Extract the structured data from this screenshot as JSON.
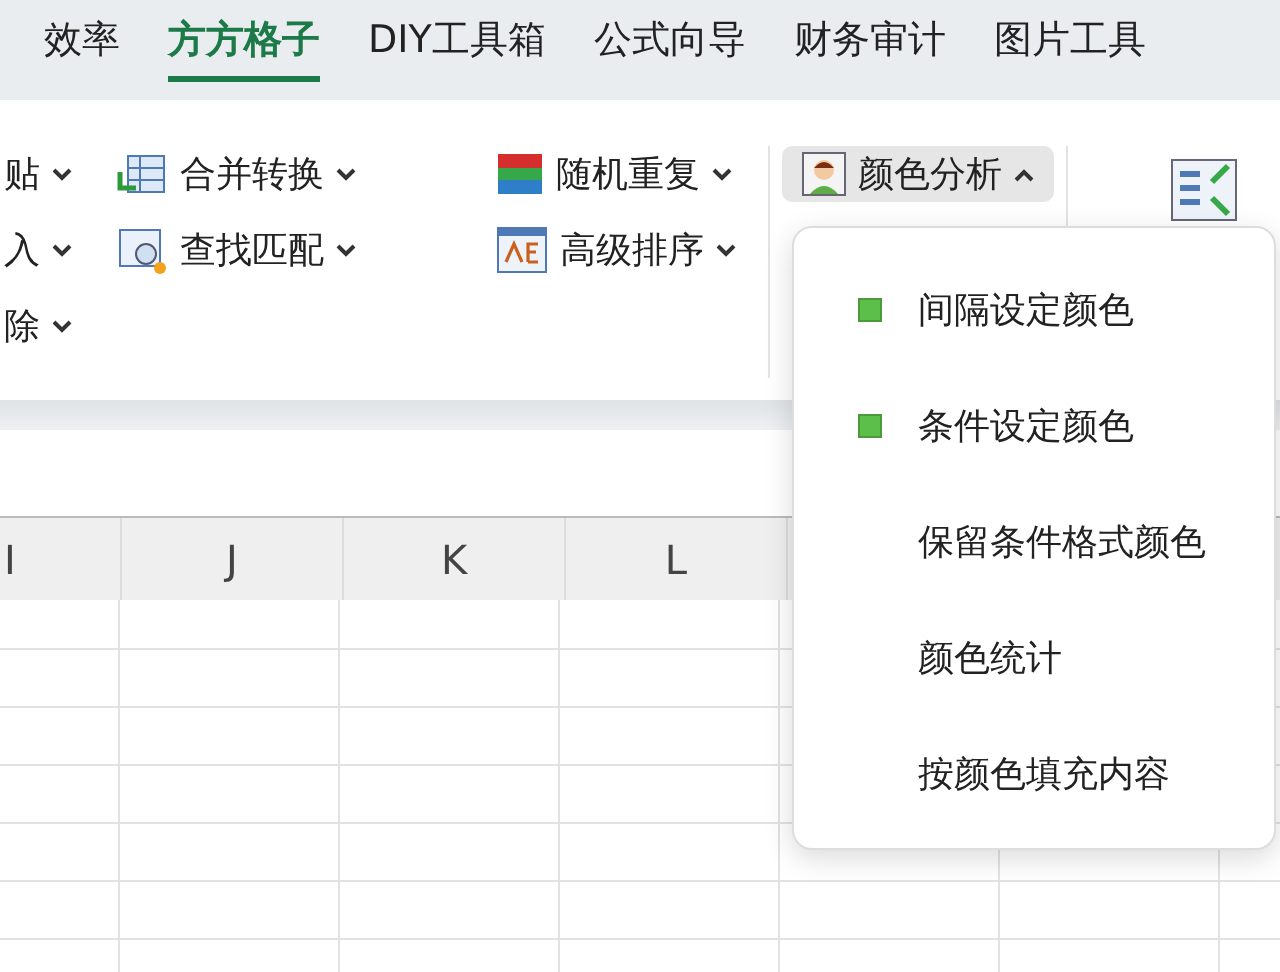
{
  "tabs": [
    {
      "label": "效率",
      "selected": false
    },
    {
      "label": "方方格子",
      "selected": true
    },
    {
      "label": "DIY工具箱",
      "selected": false
    },
    {
      "label": "公式向导",
      "selected": false
    },
    {
      "label": "财务审计",
      "selected": false
    },
    {
      "label": "图片工具",
      "selected": false
    }
  ],
  "ribbon": {
    "groups": [
      {
        "items": [
          {
            "label": "贴",
            "kind": "plain"
          },
          {
            "label": "入",
            "kind": "plain"
          },
          {
            "label": "除",
            "kind": "plain"
          }
        ]
      },
      {
        "items": [
          {
            "label": "合并转换",
            "kind": "merge"
          },
          {
            "label": "查找匹配",
            "kind": "find"
          }
        ]
      },
      {
        "items": [
          {
            "label": "随机重复",
            "kind": "random"
          },
          {
            "label": "高级排序",
            "kind": "sort"
          }
        ]
      },
      {
        "items": [
          {
            "label": "颜色分析",
            "kind": "color",
            "pressed": true
          }
        ]
      }
    ]
  },
  "menu": {
    "items": [
      {
        "label": "间隔设定颜色",
        "marked": true
      },
      {
        "label": "条件设定颜色",
        "marked": true
      },
      {
        "label": "保留条件格式颜色",
        "marked": false
      },
      {
        "label": "颜色统计",
        "marked": false
      },
      {
        "label": "按颜色填充内容",
        "marked": false
      }
    ]
  },
  "sheet": {
    "columns": [
      "I",
      "J",
      "K",
      "L"
    ]
  }
}
